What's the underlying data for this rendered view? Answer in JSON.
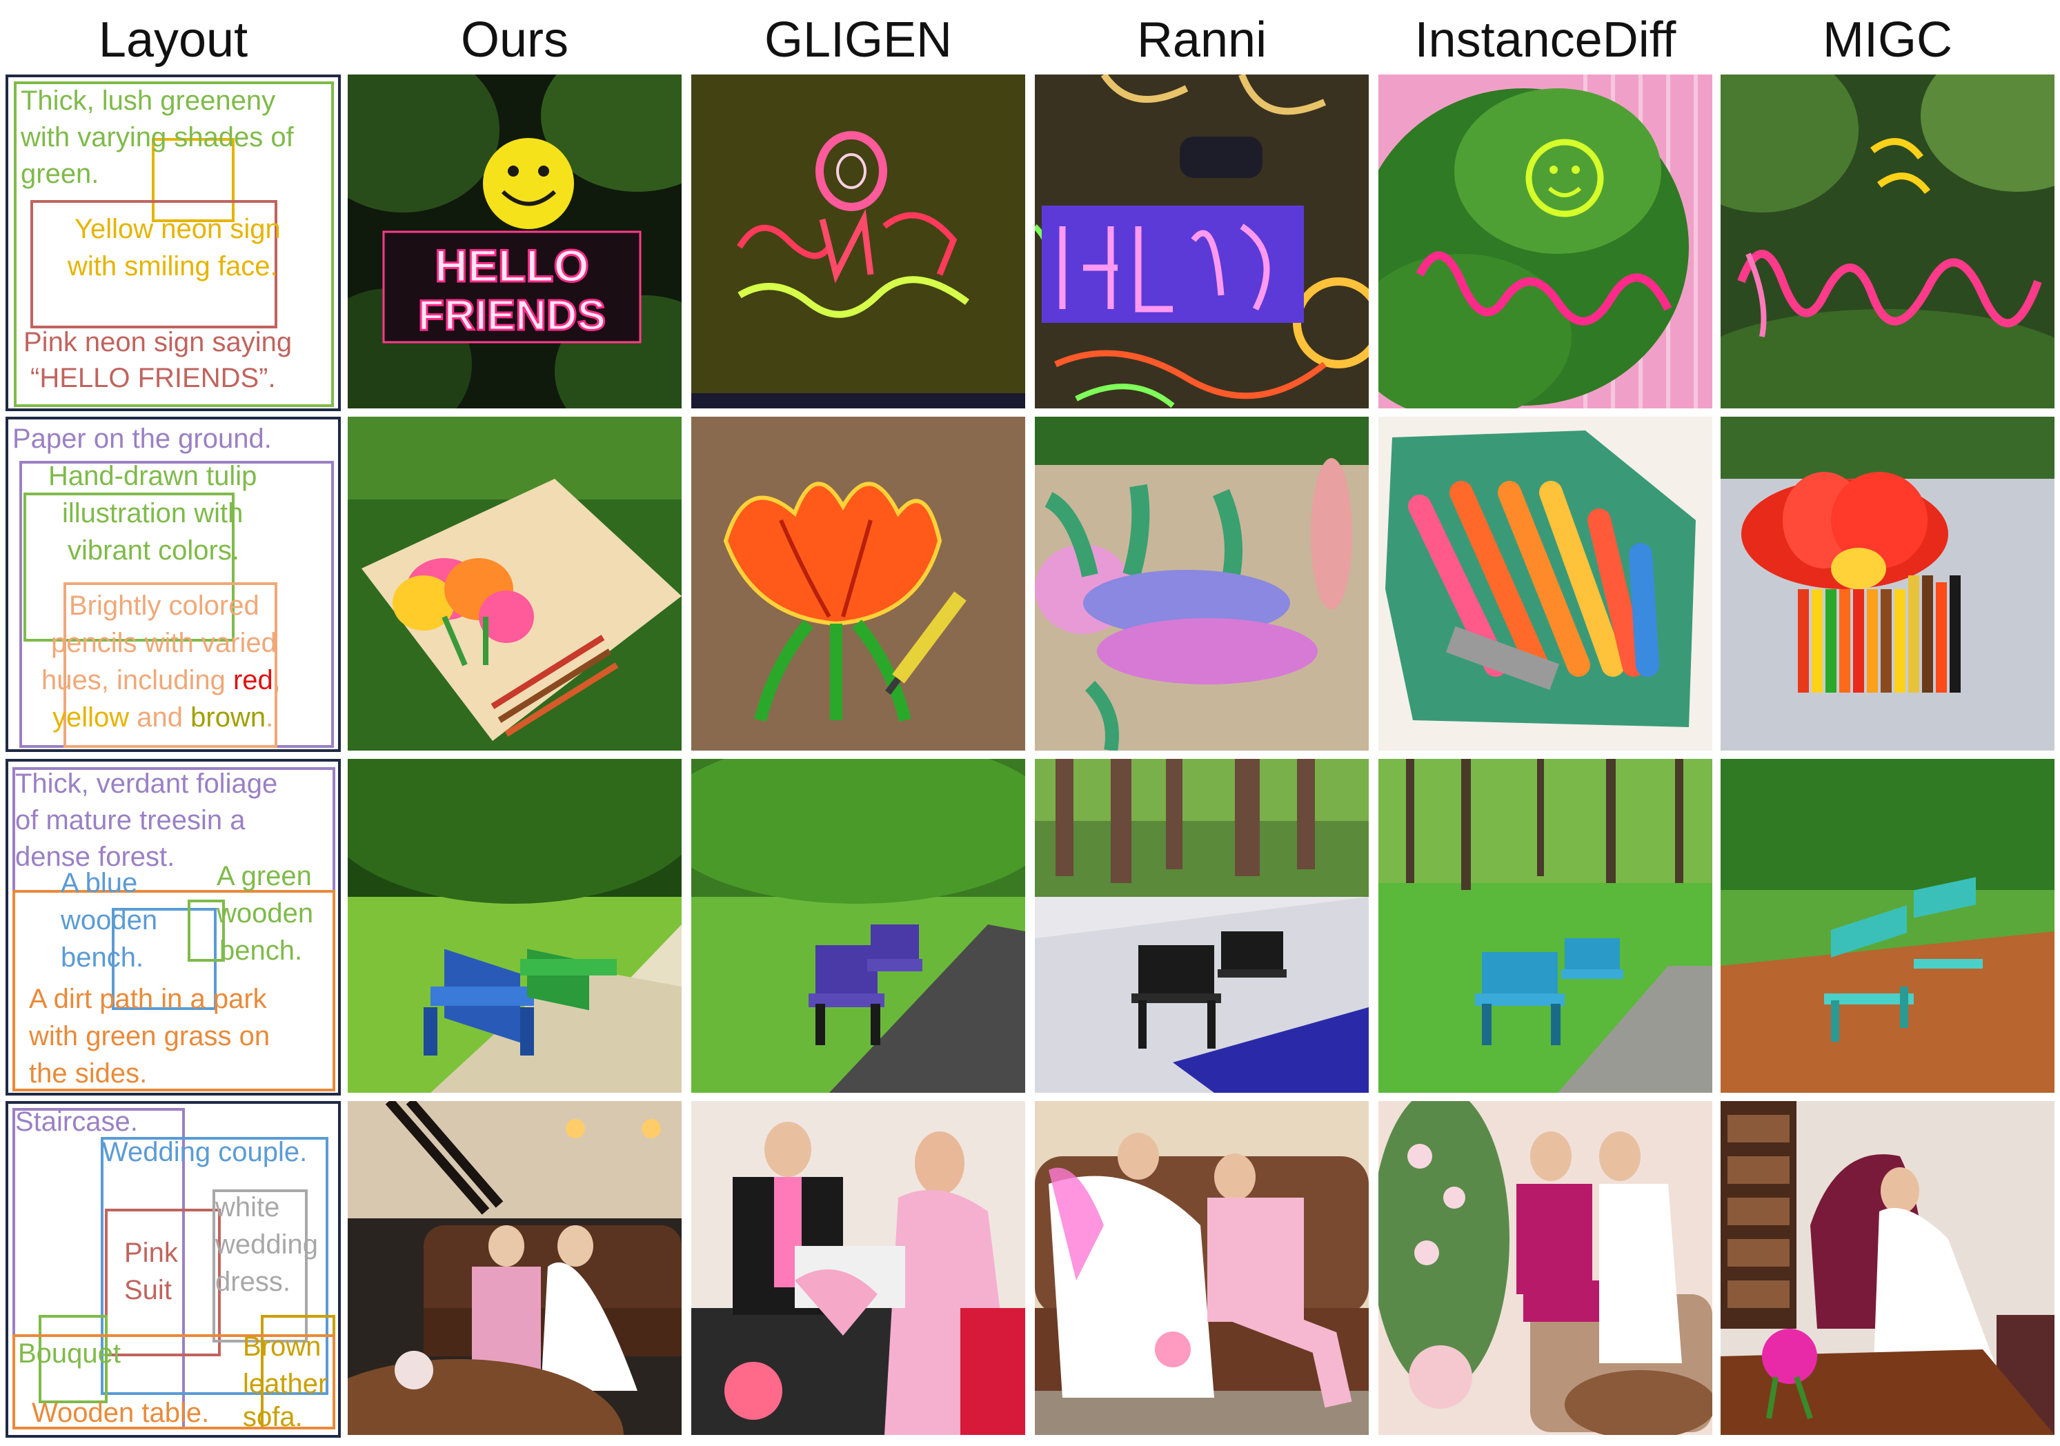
{
  "headers": [
    "Layout",
    "Ours",
    "GLIGEN",
    "Ranni",
    "InstanceDiff",
    "MIGC"
  ],
  "colors": {
    "green": "#7fba4a",
    "yellow": "#e6b400",
    "red": "#c0645e",
    "purple": "#9a80c4",
    "peach": "#f0a878",
    "blue": "#5b9bd5",
    "orange": "#e98a3a",
    "gray": "#a8a8a8",
    "gold": "#c9a000",
    "olive": "#a0a000",
    "brightred": "#e01010"
  },
  "rows": [
    {
      "layout": {
        "texts": [
          {
            "lines": [
              "Thick, lush greeneny",
              "with varying shades of",
              "green."
            ],
            "color": "#7fba4a"
          },
          {
            "lines": [
              "Yellow neon sign",
              "with smiling face."
            ],
            "color": "#e6b400"
          },
          {
            "lines": [
              "Pink neon sign saying",
              "“HELLO FRIENDS”."
            ],
            "color": "#c0645e"
          }
        ]
      },
      "sign_text": [
        "HELLO",
        "FRIENDS"
      ]
    },
    {
      "layout": {
        "texts": [
          {
            "lines": [
              "Paper on the ground."
            ],
            "color": "#9a80c4"
          },
          {
            "lines": [
              "Hand-drawn tulip",
              "illustration with",
              "vibrant colors."
            ],
            "color": "#7fba4a"
          },
          {
            "lines": [
              "Brightly colored",
              "pencils with varied"
            ],
            "color": "#f0a878"
          },
          {
            "parts": [
              "hues, including ",
              "red",
              ","
            ],
            "colors": [
              "#f0a878",
              "#e01010",
              "#f0a878"
            ]
          },
          {
            "parts": [
              "yellow",
              " and ",
              "brown",
              "."
            ],
            "colors": [
              "#e6b400",
              "#f0a878",
              "#a0a000",
              "#f0a878"
            ]
          }
        ]
      }
    },
    {
      "layout": {
        "texts": [
          {
            "lines": [
              "Thick, verdant foliage",
              "of mature treesin a",
              "dense forest."
            ],
            "color": "#9a80c4"
          },
          {
            "lines": [
              "A green",
              "wooden",
              "bench."
            ],
            "color": "#7fba4a"
          },
          {
            "lines": [
              "A blue",
              "wooden",
              "bench."
            ],
            "color": "#5b9bd5"
          },
          {
            "lines": [
              "A dirt path in a park",
              "with green grass on",
              "the sides."
            ],
            "color": "#e98a3a"
          }
        ]
      }
    },
    {
      "layout": {
        "texts": [
          {
            "lines": [
              "Staircase."
            ],
            "color": "#9a80c4"
          },
          {
            "lines": [
              "Wedding couple."
            ],
            "color": "#5b9bd5"
          },
          {
            "lines": [
              "white",
              "wedding",
              "dress."
            ],
            "color": "#a8a8a8"
          },
          {
            "lines": [
              "Pink",
              "Suit"
            ],
            "color": "#c0645e"
          },
          {
            "lines": [
              "Brown",
              "leather",
              "sofa."
            ],
            "color": "#c9a000"
          },
          {
            "lines": [
              "Bouquet"
            ],
            "color": "#7fba4a"
          },
          {
            "lines": [
              "Wooden table."
            ],
            "color": "#e98a3a"
          }
        ]
      }
    }
  ]
}
